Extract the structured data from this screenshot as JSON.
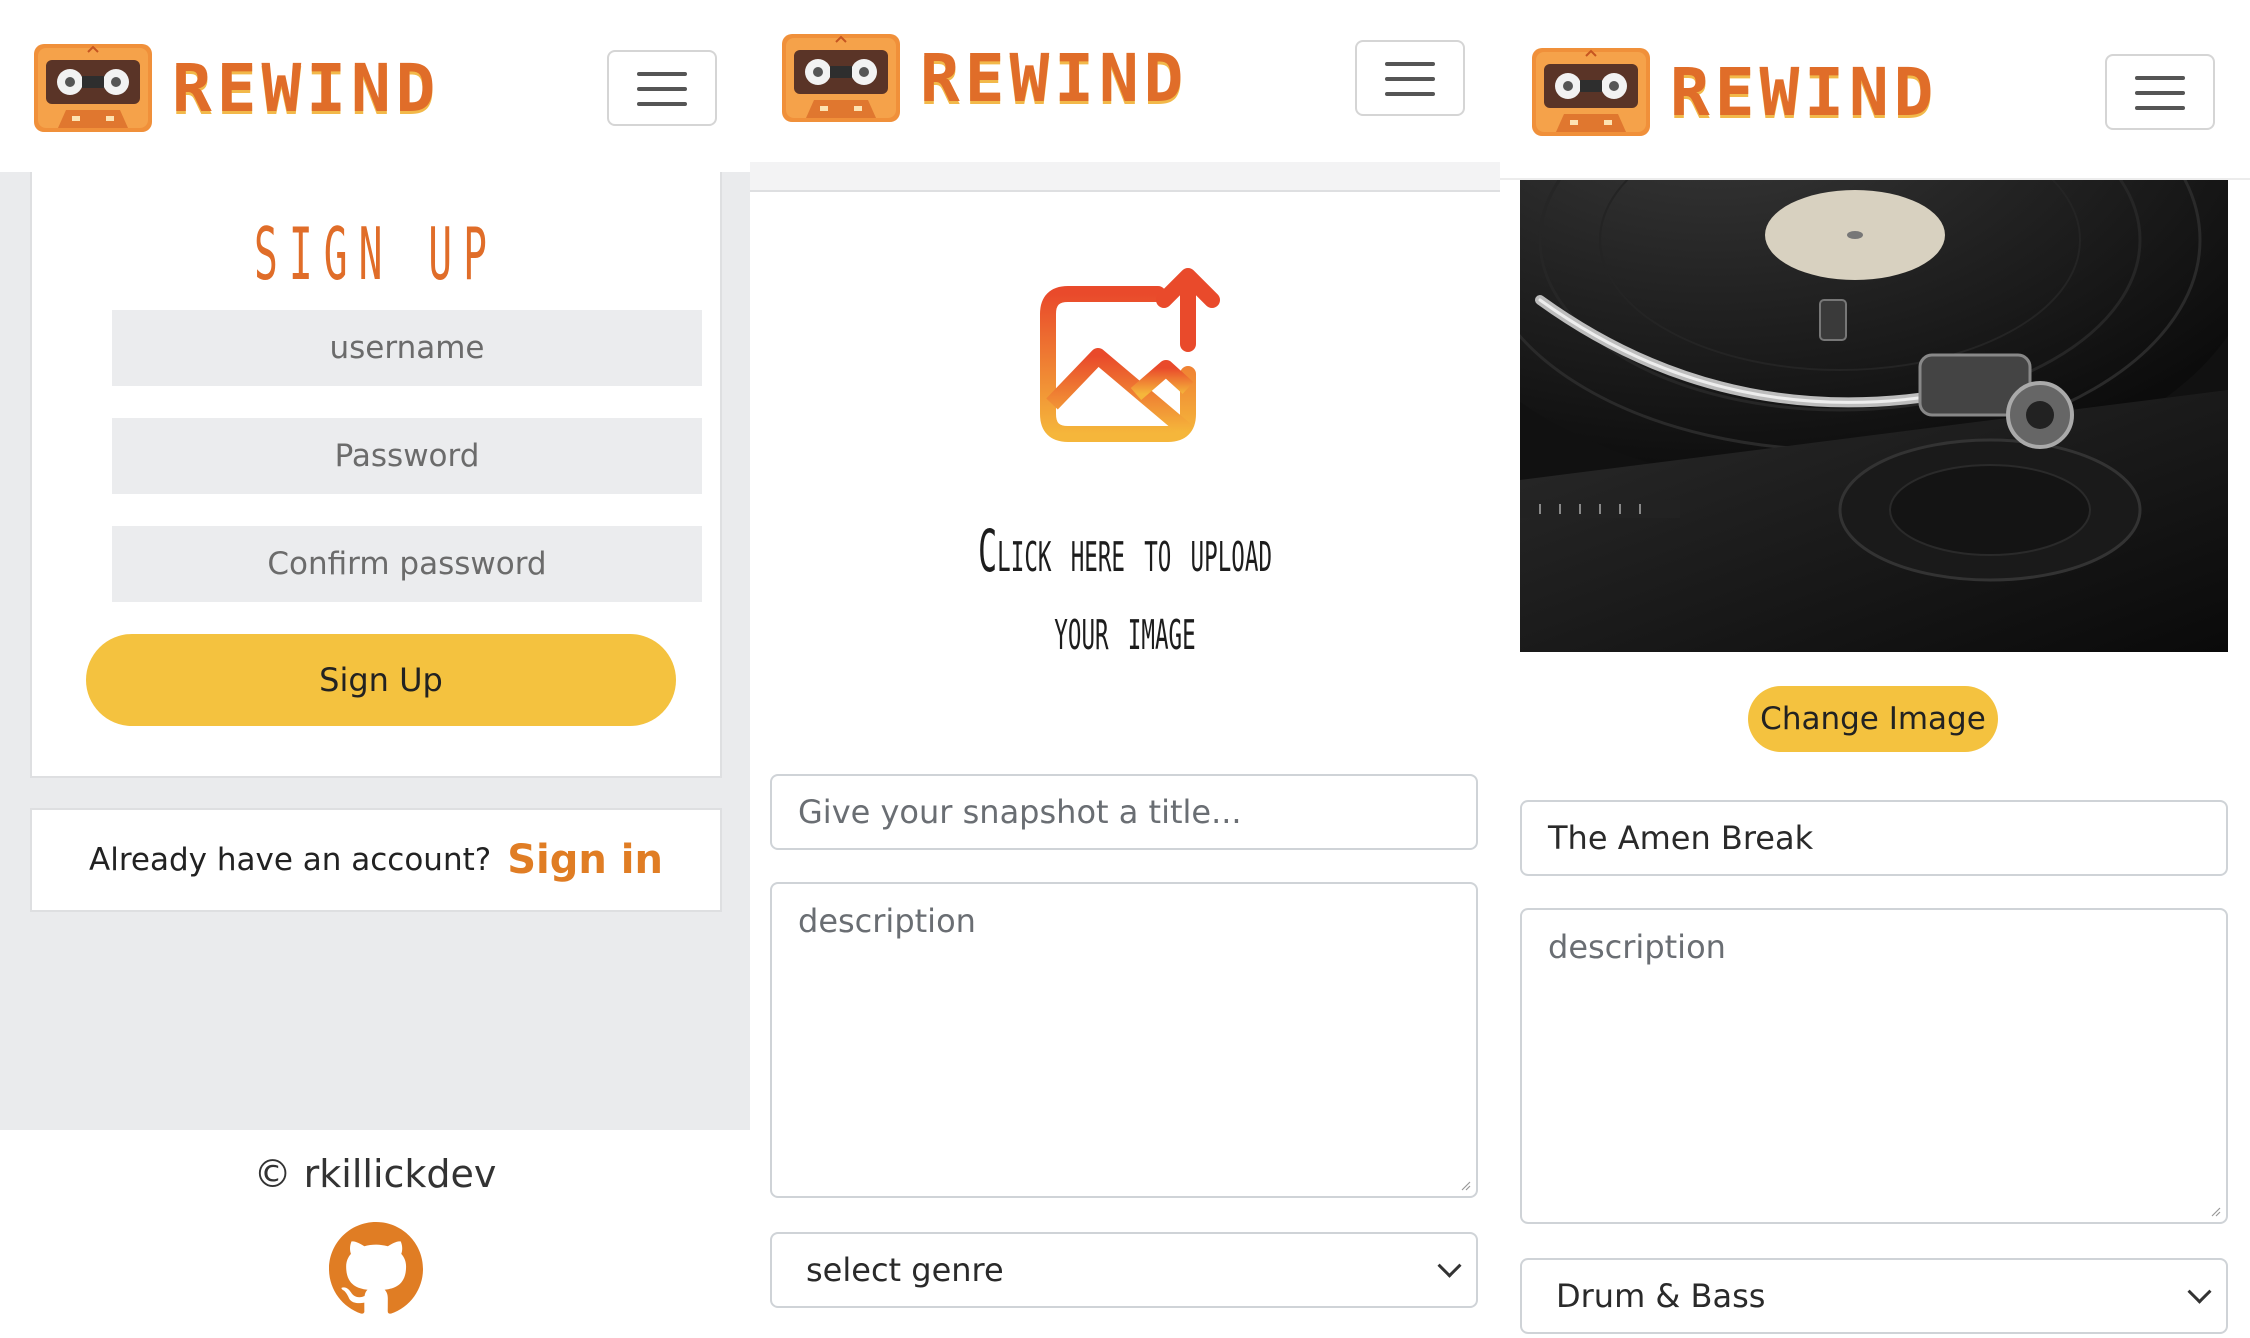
{
  "brand": {
    "name": "REWIND"
  },
  "signup": {
    "title": "SIGN UP",
    "username_placeholder": "username",
    "password_placeholder": "Password",
    "confirm_placeholder": "Confirm password",
    "submit_label": "Sign Up",
    "already_text": "Already have an account?",
    "signin_link": "Sign in"
  },
  "footer": {
    "copyright": "© rkillickdev"
  },
  "upload": {
    "prompt": "Click here to upload your image",
    "title_placeholder": "Give your snapshot a title...",
    "description_placeholder": "description",
    "genre_selected": "select genre"
  },
  "edit": {
    "change_image_label": "Change Image",
    "title_value": "The Amen Break",
    "description_placeholder": "description",
    "genre_selected": "Drum & Bass"
  },
  "icons": {
    "logo": "cassette-tape-icon",
    "menu": "hamburger-menu-icon",
    "upload": "image-upload-icon",
    "github": "github-icon",
    "select": "chevron-down-icon"
  },
  "colors": {
    "brand_orange": "#e06d29",
    "accent_yellow": "#f4c23f",
    "input_gray": "#ebecee"
  }
}
